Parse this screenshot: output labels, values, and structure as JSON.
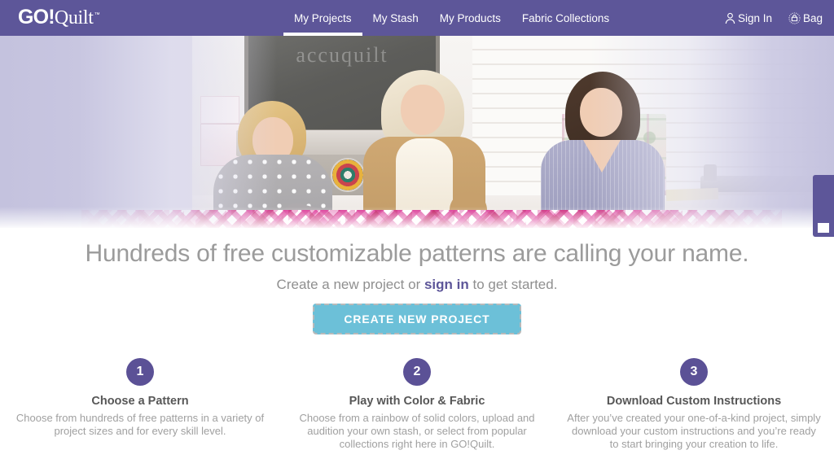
{
  "nav": {
    "logo": {
      "go": "GO!",
      "quilt": "Quilt",
      "tm": "™"
    },
    "links": [
      {
        "label": "My Projects",
        "active": true
      },
      {
        "label": "My Stash",
        "active": false
      },
      {
        "label": "My Products",
        "active": false
      },
      {
        "label": "Fabric Collections",
        "active": false
      }
    ],
    "sign_in": "Sign In",
    "bag": "Bag",
    "icons": {
      "person": "person-icon",
      "bag": "bag-icon"
    },
    "background_color": "#5d5699"
  },
  "hero": {
    "chalkboard_text": "accuquilt",
    "alt": "Three women standing at a table with a pink and white quilt",
    "background_color": "#c7c5e0"
  },
  "side_tab": {
    "name": "feedback-tab",
    "color": "#5d5699"
  },
  "main": {
    "headline": "Hundreds of free customizable patterns are calling your name.",
    "subhead_before": "Create a new project or ",
    "subhead_link": "sign in",
    "subhead_after": " to get started.",
    "cta_label": "CREATE NEW PROJECT",
    "cta_color": "#6cc0d8",
    "accent_color": "#5b5196",
    "steps": [
      {
        "number": "1",
        "title": "Choose a Pattern",
        "body": "Choose from hundreds of free patterns in a variety of project sizes and for every skill level."
      },
      {
        "number": "2",
        "title": "Play with Color & Fabric",
        "body": "Choose from a rainbow of solid colors, upload and audition your own stash, or select from popular collections right here in GO!Quilt."
      },
      {
        "number": "3",
        "title": "Download Custom Instructions",
        "body": "After you’ve created your one-of-a-kind project, simply download your custom instructions and you’re ready to start bringing your creation to life."
      }
    ]
  }
}
